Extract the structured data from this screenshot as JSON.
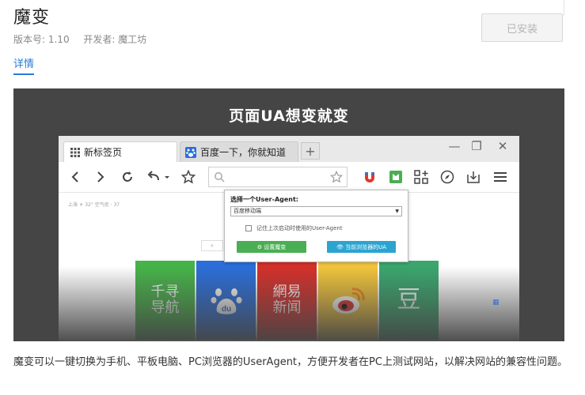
{
  "app": {
    "title": "魔变",
    "version": "版本号: 1.10",
    "developer": "开发者: 魔工坊",
    "install_label": "已安装",
    "details_tab": "详情"
  },
  "promo": {
    "headline": "页面UA想变就变",
    "browser": {
      "tabs": [
        {
          "label": "新标签页",
          "icon": "grid-icon"
        },
        {
          "label": "百度一下，你就知道",
          "icon": "baidu-paw-icon"
        }
      ],
      "newtab_label": "+",
      "window_controls": {
        "minimize": "—",
        "maximize": "❐",
        "close": "✕"
      },
      "weather": "上海  ☀ 32°  空气优 · 37",
      "mini_search": "⌕",
      "popup": {
        "label": "选择一个User-Agent:",
        "selected": "百度移动端",
        "remember": "记住上次启动时使用的User-Agent",
        "settings_button": "⚙ 设置魔变",
        "current_button": "👁 当前浏览器的UA"
      },
      "tiles": [
        {
          "label": "千寻\n导航",
          "color": "#46b348"
        },
        {
          "label": "du",
          "color": "#2b6ed9"
        },
        {
          "label": "網易\n新闻",
          "color": "#d4302b"
        },
        {
          "label": "◉",
          "color": "#f2c53b"
        },
        {
          "label": "豆",
          "color": "#3aa66d"
        }
      ]
    }
  },
  "description": "魔变可以一键切换为手机、平板电脑、PC浏览器的UserAgent，方便开发者在PC上测试网站，以解决网站的兼容性问题。"
}
